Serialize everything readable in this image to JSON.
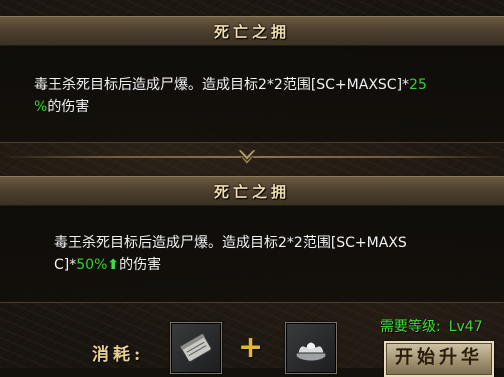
{
  "current_skill": {
    "title": "死亡之拥",
    "desc_text": "毒王杀死目标后造成尸爆。造成目标2*2范围[SC+MAXSC]*",
    "desc_value": "25",
    "desc_value_line2": "%",
    "desc_suffix": "的伤害"
  },
  "next_skill": {
    "title": "死亡之拥",
    "desc_line1": "毒王杀死目标后造成尸爆。造成目标2*2范围[SC+MAXS",
    "desc_line2_prefix": "C]*",
    "desc_value": "50%",
    "desc_arrow": "⬆",
    "desc_suffix": "的伤害"
  },
  "upgrade": {
    "consume_label": "消耗:",
    "plus_sign": "+",
    "items": [
      {
        "icon": "scroll-book-icon"
      },
      {
        "icon": "silver-ingot-icon"
      }
    ],
    "level_label": "需要等级:",
    "level_value": "Lv47",
    "button_label": "开始升华"
  },
  "colors": {
    "accent_green": "#33d12e",
    "title_text": "#efdcb0",
    "label_gold": "#e7cf8e",
    "plus_gold": "#e2b53c"
  }
}
